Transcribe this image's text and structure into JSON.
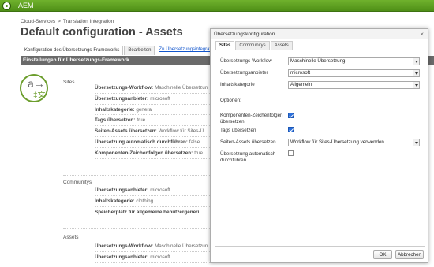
{
  "app": {
    "title": "AEM"
  },
  "breadcrumb": {
    "item1": "Cloud-Services",
    "separator": ">",
    "item2": "Translation Integration"
  },
  "page": {
    "title": "Default configuration - Assets"
  },
  "page_tabs": [
    "Konfiguration des Übersetzungs-Frameworks",
    "Bearbeiten",
    "Zu Übersetzungsintegrations-Proje"
  ],
  "section": {
    "title": "Einstellungen für Übersetzungs-Framework"
  },
  "icon": {
    "name": "translation-icon",
    "glyph_top": "a→",
    "glyph_bottom": "‡文",
    "color": "#6c9e2d"
  },
  "sites": {
    "label": "Sites",
    "rows": [
      {
        "label": "Übersetzungs-Workflow:",
        "value": "Maschinelle Übersetzun"
      },
      {
        "label": "Übersetzungsanbieter:",
        "value": "microsoft"
      },
      {
        "label": "Inhaltskategorie:",
        "value": "general"
      },
      {
        "label": "Tags übersetzen:",
        "value": "true"
      },
      {
        "label": "Seiten-Assets übersetzen:",
        "value": "Workflow für Sites-Ü"
      },
      {
        "label": "Übersetzung automatisch durchführen:",
        "value": "false"
      },
      {
        "label": "Komponenten-Zeichenfolgen übersetzen:",
        "value": "true"
      }
    ]
  },
  "communities": {
    "label": "Communitys",
    "rows": [
      {
        "label": "Übersetzungsanbieter:",
        "value": "microsoft"
      },
      {
        "label": "Inhaltskategorie:",
        "value": "clothing"
      },
      {
        "label": "Speicherplatz für allgemeine benutzergeneri",
        "value": ""
      }
    ]
  },
  "assets": {
    "label": "Assets",
    "rows": [
      {
        "label": "Übersetzungs-Workflow:",
        "value": "Maschinelle Übersetzun"
      },
      {
        "label": "Übersetzungsanbieter:",
        "value": "microsoft"
      }
    ]
  },
  "dialog": {
    "title": "Übersetzungskonfiguration",
    "close": "×",
    "tabs": [
      "Sites",
      "Communitys",
      "Assets"
    ],
    "active_tab": "Sites",
    "fields": {
      "workflow_label": "Übersetzungs-Workflow",
      "workflow_value": "Maschinelle Übersetzung",
      "provider_label": "Übersetzungsanbieter",
      "provider_value": "microsoft",
      "category_label": "Inhaltskategorie",
      "category_value": "Allgemein",
      "options_heading": "Optionen:",
      "components_label": "Komponenten-Zeichenfolgen übersetzen",
      "components_checked": true,
      "tags_label": "Tags übersetzen",
      "tags_checked": true,
      "page_assets_label": "Seiten-Assets übersetzen",
      "page_assets_value": "Workflow für Sites-Übersetzung verwenden",
      "auto_label": "Übersetzung automatisch durchführen",
      "auto_checked": false
    },
    "ok_label": "OK",
    "cancel_label": "Abbrechen"
  },
  "colors": {
    "accent": "#5a9e1f",
    "section_bar": "#6a6a6a",
    "checkbox": "#2a6fdb"
  }
}
